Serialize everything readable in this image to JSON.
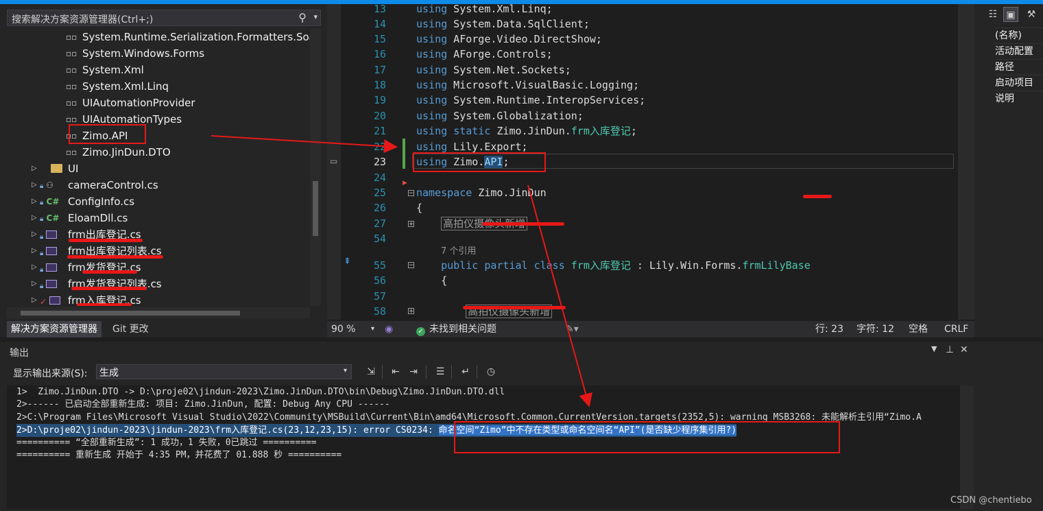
{
  "solution_explorer": {
    "search_placeholder": "搜索解决方案资源管理器(Ctrl+;)",
    "references": [
      "System.Runtime.Serialization.Formatters.Soap",
      "System.Windows.Forms",
      "System.Xml",
      "System.Xml.Linq",
      "UIAutomationProvider",
      "UIAutomationTypes",
      "Zimo.API",
      "Zimo.JinDun.DTO"
    ],
    "items": [
      {
        "label": "UI",
        "icon": "folder-icon"
      },
      {
        "label": "cameraControl.cs",
        "icon": "user-control-icon"
      },
      {
        "label": "ConfigInfo.cs",
        "icon": "csharp-file-icon"
      },
      {
        "label": "EloamDll.cs",
        "icon": "csharp-file-icon"
      },
      {
        "label": "frm出库登记.cs",
        "icon": "form-icon"
      },
      {
        "label": "frm出库登记列表.cs",
        "icon": "form-icon"
      },
      {
        "label": "frm发货登记.cs",
        "icon": "form-icon"
      },
      {
        "label": "frm发货登记列表.cs",
        "icon": "form-icon"
      },
      {
        "label": "frm入库登记.cs",
        "icon": "form-icon"
      }
    ],
    "tabs": [
      "解决方案资源管理器",
      "Git 更改"
    ]
  },
  "editor": {
    "lines": [
      {
        "n": "13",
        "code": [
          {
            "t": "using",
            "c": "kw"
          },
          {
            "t": " System.Xml.Linq;"
          }
        ]
      },
      {
        "n": "14",
        "code": [
          {
            "t": "using",
            "c": "kw"
          },
          {
            "t": " System.Data.SqlClient;"
          }
        ]
      },
      {
        "n": "15",
        "code": [
          {
            "t": "using",
            "c": "kw"
          },
          {
            "t": " AForge.Video.DirectShow;"
          }
        ]
      },
      {
        "n": "16",
        "code": [
          {
            "t": "using",
            "c": "kw"
          },
          {
            "t": " AForge.Controls;"
          }
        ]
      },
      {
        "n": "17",
        "code": [
          {
            "t": "using",
            "c": "kw"
          },
          {
            "t": " System.Net.Sockets;"
          }
        ]
      },
      {
        "n": "18",
        "code": [
          {
            "t": "using",
            "c": "kw"
          },
          {
            "t": " Microsoft.VisualBasic.Logging;"
          }
        ]
      },
      {
        "n": "19",
        "code": [
          {
            "t": "using",
            "c": "kw"
          },
          {
            "t": " System.Runtime.InteropServices;"
          }
        ]
      },
      {
        "n": "20",
        "code": [
          {
            "t": "using",
            "c": "kw"
          },
          {
            "t": " System.Globalization;"
          }
        ]
      },
      {
        "n": "21",
        "code": [
          {
            "t": "using",
            "c": "kw"
          },
          {
            "t": " "
          },
          {
            "t": "static",
            "c": "kw"
          },
          {
            "t": " Zimo.JinDun."
          },
          {
            "t": "frm入库登记",
            "c": "ty"
          },
          {
            "t": ";"
          }
        ]
      },
      {
        "n": "22",
        "code": [
          {
            "t": "using",
            "c": "kw"
          },
          {
            "t": " Lily.Export;"
          }
        ]
      },
      {
        "n": "23",
        "code": [
          {
            "t": "using",
            "c": "kw"
          },
          {
            "t": " Zimo."
          },
          {
            "t": "API",
            "c": "sel"
          },
          {
            "t": ";"
          }
        ]
      },
      {
        "n": "24",
        "code": []
      },
      {
        "n": "25",
        "code": [
          {
            "t": "namespace",
            "c": "kw"
          },
          {
            "t": " Zimo.JinDun"
          }
        ]
      },
      {
        "n": "26",
        "code": [
          {
            "t": "{"
          }
        ]
      },
      {
        "n": "27",
        "code": [
          {
            "t": "    "
          },
          {
            "t": "高拍仪摄像头新增",
            "c": "collapsed"
          }
        ]
      },
      {
        "n": "54",
        "code": []
      },
      {
        "n": "55",
        "code": [
          {
            "t": "    "
          },
          {
            "t": "public",
            "c": "kw"
          },
          {
            "t": " "
          },
          {
            "t": "partial",
            "c": "kw"
          },
          {
            "t": " "
          },
          {
            "t": "class",
            "c": "kw"
          },
          {
            "t": " "
          },
          {
            "t": "frm入库登记",
            "c": "ty"
          },
          {
            "t": " : Lily.Win.Forms."
          },
          {
            "t": "frmLilyBase",
            "c": "ty"
          }
        ]
      },
      {
        "n": "56",
        "code": [
          {
            "t": "    {"
          }
        ]
      },
      {
        "n": "57",
        "code": []
      },
      {
        "n": "58",
        "code": [
          {
            "t": "        "
          },
          {
            "t": "高拍仪摄像头新增",
            "c": "collapsed"
          }
        ]
      }
    ],
    "reference_count": "7 个引用",
    "status": {
      "zoom": "90 %",
      "issues": "未找到相关问题",
      "line": "行: 23",
      "char": "字符: 12",
      "spacing": "空格",
      "eol": "CRLF"
    }
  },
  "properties": {
    "rows": [
      "(名称)",
      "活动配置",
      "路径",
      "启动项目",
      "说明"
    ]
  },
  "output": {
    "title": "输出",
    "source_label": "显示输出来源(S):",
    "source_value": "生成",
    "lines": [
      "1>  Zimo.JinDun.DTO -> D:\\proje02\\jindun-2023\\Zimo.JinDun.DTO\\bin\\Debug\\Zimo.JinDun.DTO.dll",
      "2>------ 已启动全部重新生成: 项目: Zimo.JinDun, 配置: Debug Any CPU ------",
      "2>C:\\Program Files\\Microsoft Visual Studio\\2022\\Community\\MSBuild\\Current\\Bin\\amd64\\Microsoft.Common.CurrentVersion.targets(2352,5): warning MSB3268: 未能解析主引用“Zimo.A",
      "2>D:\\proje02\\jindun-2023\\jindun-2023\\frm入库登记.cs(23,12,23,15): error CS0234: ",
      "========== “全部重新生成”: 1 成功，1 失败，0已跳过 ==========",
      "========== 重新生成 开始于 4:35 PM，并花费了 01.888 秒 =========="
    ],
    "error_message": "命名空间“Zimo”中不存在类型或命名空间名“API”(是否缺少程序集引用?)"
  },
  "watermark": "CSDN @chentiebo",
  "colors": {
    "accent": "#0e8ae8",
    "annotation": "#e81818",
    "keyword": "#569cd6",
    "type": "#4ec9b0",
    "selection": "#264f78"
  }
}
